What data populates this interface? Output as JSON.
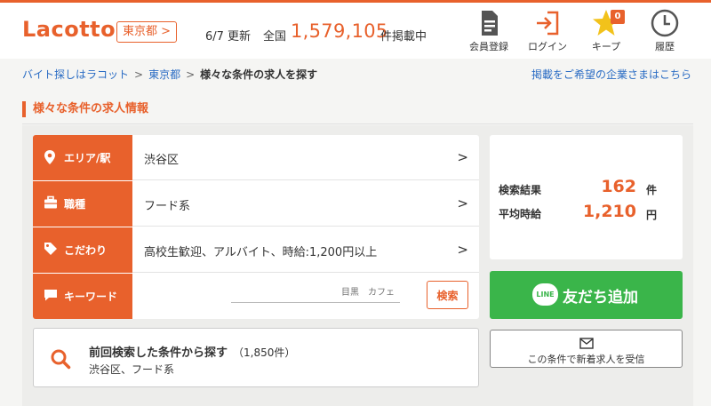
{
  "header": {
    "logo": "Lacotto",
    "prefecture_button": "東京都 >",
    "update_text": "6/7 更新",
    "total_label": "全国",
    "total_count": "1,579,105",
    "total_suffix": "件掲載中",
    "nav": [
      {
        "label": "会員登録",
        "icon": "member-register-icon"
      },
      {
        "label": "ログイン",
        "icon": "login-icon"
      },
      {
        "label": "キープ",
        "icon": "star-icon",
        "badge": "0"
      },
      {
        "label": "履歴",
        "icon": "clock-icon"
      }
    ]
  },
  "breadcrumb": {
    "items": [
      "バイト探しはラコット",
      "東京都",
      "様々な条件の求人を探す"
    ],
    "separator": ">"
  },
  "advertiser_link": "掲載をご希望の企業さまはこちら",
  "section_title": "様々な条件の求人情報",
  "search_form": {
    "rows": [
      {
        "label": "エリア/駅",
        "value": "渋谷区",
        "icon": "map-pin-icon"
      },
      {
        "label": "職種",
        "value": "フード系",
        "icon": "briefcase-icon"
      },
      {
        "label": "こだわり",
        "value": "高校生歓迎、アルバイト、時給:1,200円以上",
        "icon": "tag-icon"
      },
      {
        "label": "キーワード",
        "value": "",
        "icon": "speech-bubble-icon"
      }
    ],
    "keyword_placeholder": "目黒　カフェ",
    "search_button": "検索",
    "chevron": ">"
  },
  "results": {
    "count_label": "検索結果",
    "count_value": "162",
    "count_unit": "件",
    "avg_label": "平均時給",
    "avg_value": "1,210",
    "avg_unit": "円"
  },
  "line_button": {
    "logo": "LINE",
    "label": "友だち追加"
  },
  "previous_search": {
    "title": "前回検索した条件から探す",
    "count": "（1,850件）",
    "conditions": "渋谷区、フード系"
  },
  "notify_button": {
    "label": "この条件で新着求人を受信"
  },
  "colors": {
    "accent": "#e8612c",
    "link": "#2a6cc4",
    "line_green": "#3ab54a"
  }
}
